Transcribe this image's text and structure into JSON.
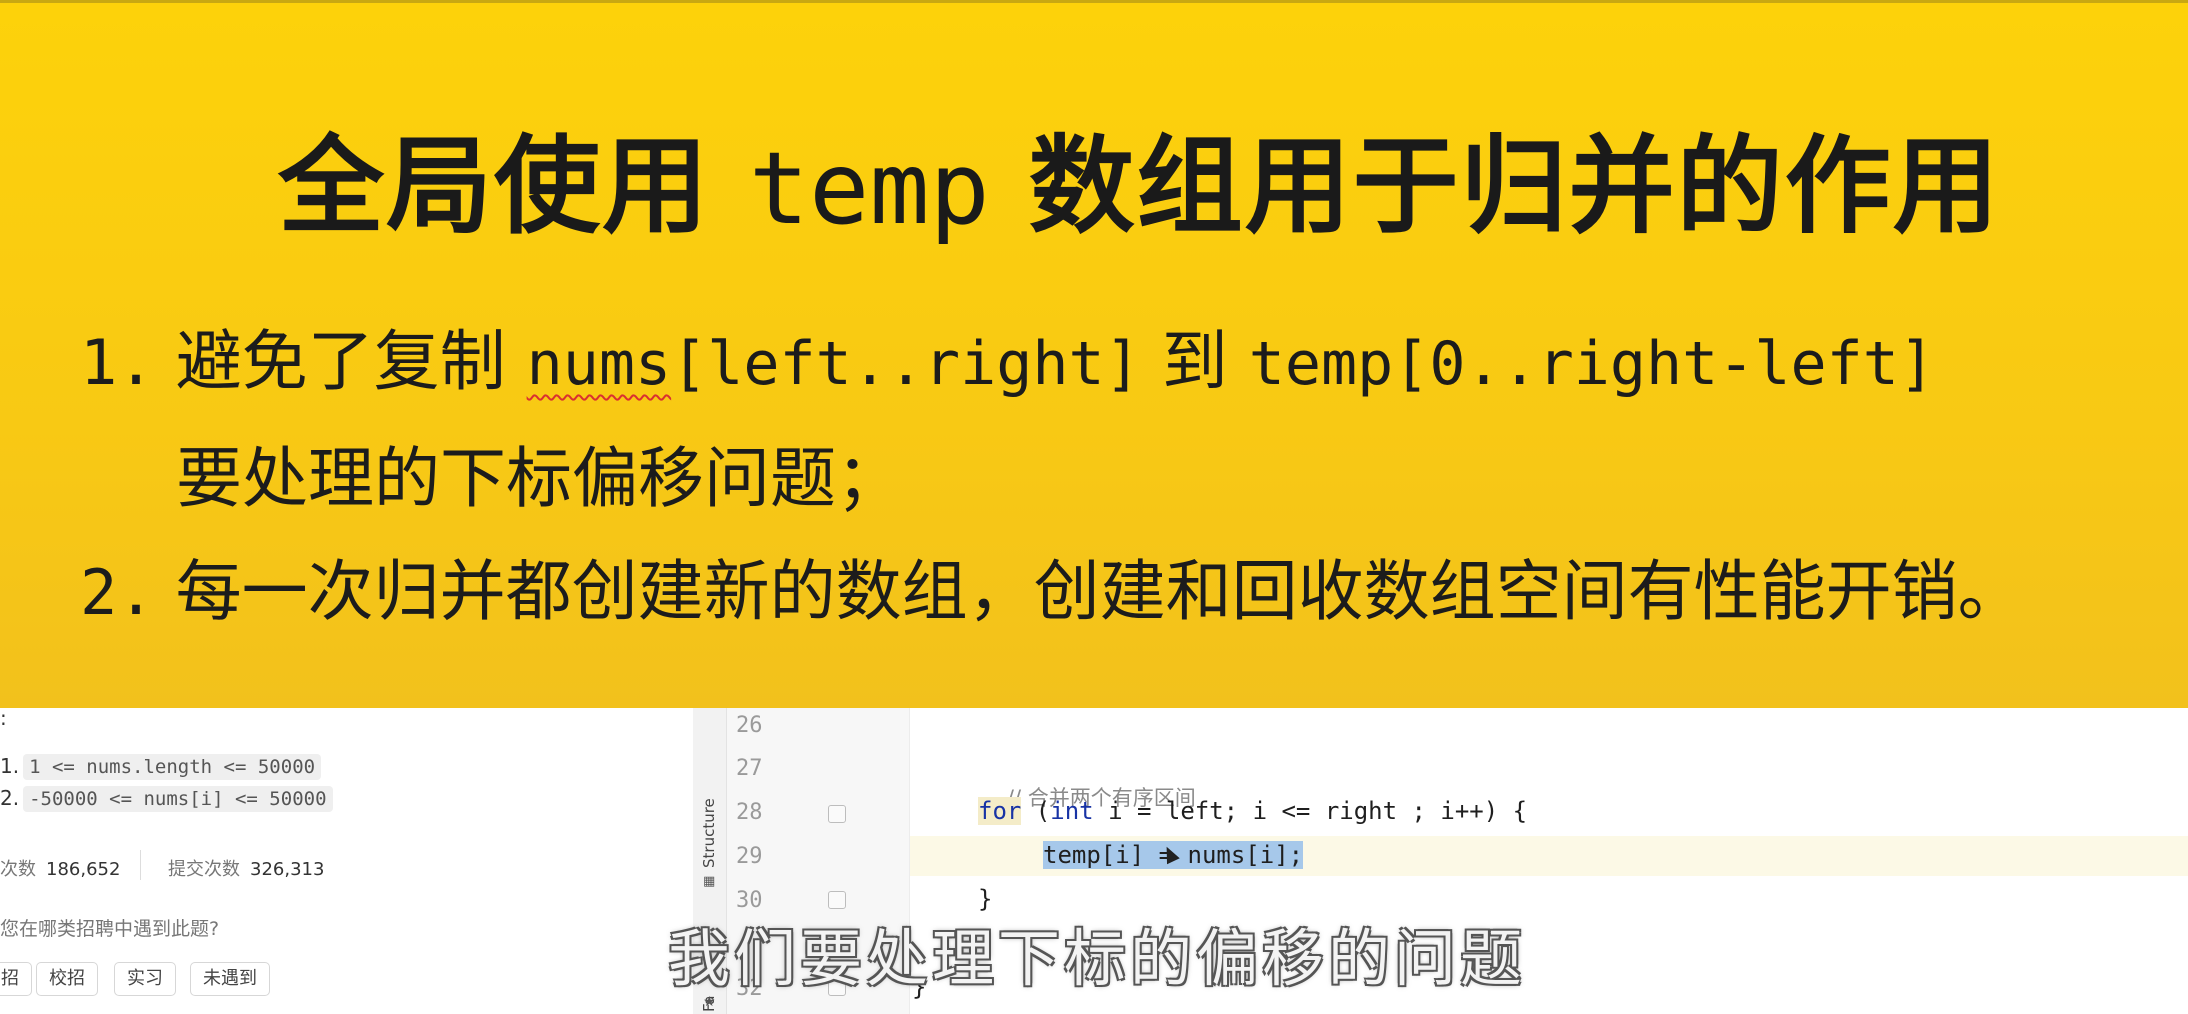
{
  "slide": {
    "title_part1": "全局使用",
    "title_code": "temp",
    "title_part2": "数组用于归并的作用",
    "point1": {
      "num": "1.",
      "text_a": "避免了复制",
      "code_a": "nums",
      "code_b": "[left..right]",
      "text_b": "到",
      "code_c": "temp[0..right-left]",
      "line2": "要处理的下标偏移问题；"
    },
    "point2": {
      "num": "2.",
      "text": "每一次归并都创建新的数组，创建和回收数组空间有性能开销。"
    }
  },
  "problem_panel": {
    "colon": ":",
    "constraints": [
      {
        "num": "1.",
        "code": "1 <= nums.length <= 50000"
      },
      {
        "num": "2.",
        "code": "-50000 <= nums[i] <= 50000"
      }
    ],
    "stats": {
      "accepted_label": "次数",
      "accepted_value": "186,652",
      "submissions_label": "提交次数",
      "submissions_value": "326,313"
    },
    "question": "您在哪类招聘中遇到此题?",
    "chips": [
      "招",
      "校招",
      "实习",
      "未遇到"
    ]
  },
  "ide": {
    "sidebar_structure": "Structure",
    "sidebar_favorites": "Fa",
    "line_numbers": [
      "26",
      "27",
      "28",
      "29",
      "30",
      "32"
    ],
    "comment": "// 合并两个有序区间",
    "for_kw": "for",
    "int_kw": "int",
    "for_rest": " i = left; i <= right ; i++) {",
    "selected_code": "temp[i] = nums[i];",
    "close_brace_inner": "}",
    "close_brace_outer": "}"
  },
  "subtitle": "我们要处理下标的偏移的问题",
  "colors": {
    "slide_bg": "#fdd20a",
    "keyword": "#1833a5",
    "selection": "#a6c8ea"
  }
}
